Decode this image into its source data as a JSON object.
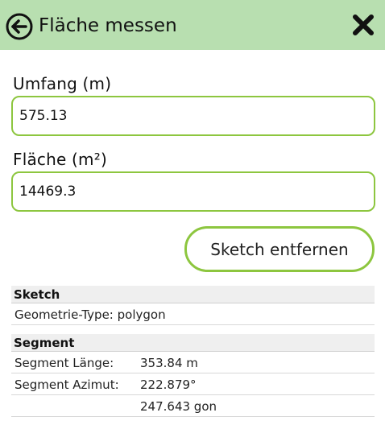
{
  "header": {
    "title": "Fläche messen",
    "back_icon": "arrow-left-circle-icon",
    "close_icon": "close-x-icon",
    "background": "#b8dfb0"
  },
  "accent": "#8dc63f",
  "fields": {
    "perimeter": {
      "label": "Umfang (m)",
      "value": "575.13"
    },
    "area": {
      "label": "Fläche (m²)",
      "value": "14469.3"
    }
  },
  "actions": {
    "remove_sketch": "Sketch entfernen"
  },
  "sketch": {
    "title": "Sketch",
    "geometry_type": "Geometrie-Type: polygon"
  },
  "segment": {
    "title": "Segment",
    "length_label": "Segment Länge:",
    "length_value": "353.84 m",
    "azimuth_label": "Segment Azimut:",
    "azimuth_value": "222.879°",
    "azimuth_gon": "247.643 gon"
  }
}
